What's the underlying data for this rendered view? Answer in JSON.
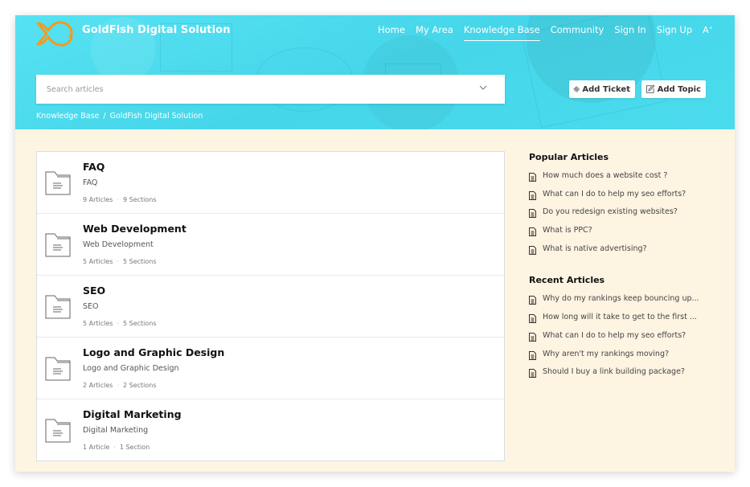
{
  "app": {
    "brand": "GoldFish Digital Solution",
    "logo_icon": "goldfish-logo-icon",
    "colors": {
      "hero": "#4fdcee",
      "logo": "#f39a1f",
      "body_bg": "#fdf4e2"
    }
  },
  "nav": {
    "items": [
      {
        "label": "Home",
        "active": false
      },
      {
        "label": "My Area",
        "active": false
      },
      {
        "label": "Knowledge Base",
        "active": true
      },
      {
        "label": "Community",
        "active": false
      },
      {
        "label": "Sign In",
        "active": false
      },
      {
        "label": "Sign Up",
        "active": false
      }
    ],
    "font_size_toggle": "A"
  },
  "search": {
    "placeholder": "Search articles",
    "value": ""
  },
  "actions": {
    "add_ticket": "Add Ticket",
    "add_topic": "Add Topic"
  },
  "breadcrumb": {
    "items": [
      "Knowledge Base",
      "GoldFish Digital Solution"
    ],
    "separator": "/"
  },
  "categories": [
    {
      "title": "FAQ",
      "subtitle": "FAQ",
      "articles": "9 Articles",
      "sections": "9 Sections"
    },
    {
      "title": "Web Development",
      "subtitle": "Web Development",
      "articles": "5 Articles",
      "sections": "5 Sections"
    },
    {
      "title": "SEO",
      "subtitle": "SEO",
      "articles": "5 Articles",
      "sections": "5 Sections"
    },
    {
      "title": "Logo and Graphic Design",
      "subtitle": "Logo and Graphic Design",
      "articles": "2 Articles",
      "sections": "2 Sections"
    },
    {
      "title": "Digital Marketing",
      "subtitle": "Digital Marketing",
      "articles": "1 Article",
      "sections": "1 Section"
    }
  ],
  "popular": {
    "heading": "Popular Articles",
    "items": [
      "How much does a website cost ?",
      "What can I do to help my seo efforts?",
      "Do you redesign existing websites?",
      "What is PPC?",
      "What is native advertising?"
    ]
  },
  "recent": {
    "heading": "Recent Articles",
    "items": [
      "Why do my rankings keep bouncing up...",
      "How long will it take to get to the first ...",
      "What can I do to help my seo efforts?",
      "Why aren't my rankings moving?",
      "Should I buy a link building package?"
    ]
  }
}
